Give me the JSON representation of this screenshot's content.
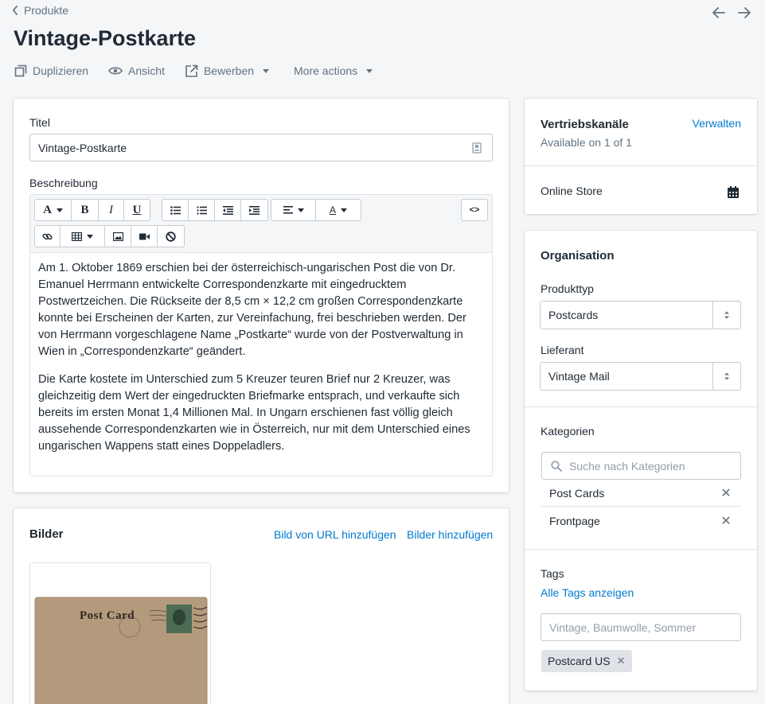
{
  "header": {
    "breadcrumb": "Produkte",
    "title": "Vintage-Postkarte",
    "actions": {
      "duplicate": "Duplizieren",
      "view": "Ansicht",
      "promote": "Bewerben",
      "more": "More actions"
    }
  },
  "main": {
    "title_label": "Titel",
    "title_value": "Vintage-Postkarte",
    "description_label": "Beschreibung",
    "description": [
      "Am 1. Oktober 1869 erschien bei der österreichisch-ungarischen Post die von Dr. Emanuel Herrmann entwickelte Correspondenzkarte mit eingedrucktem Postwertzeichen. Die Rückseite der 8,5 cm × 12,2 cm großen Correspondenzkarte konnte bei Erscheinen der Karten, zur Vereinfachung, frei beschrieben werden. Der von Herrmann vorgeschlagene Name „Postkarte“ wurde von der Postverwaltung in Wien in „Correspondenzkarte“ geändert.",
      "Die Karte kostete im Unterschied zum 5 Kreuzer teuren Brief nur 2 Kreuzer, was gleichzeitig dem Wert der eingedruckten Briefmarke entsprach, und verkaufte sich bereits im ersten Monat 1,4 Millionen Mal. In Ungarn erschienen fast völlig gleich aussehende Correspondenzkarten wie in Österreich, nur mit dem Unterschied eines ungarischen Wappens statt eines Doppeladlers."
    ],
    "toolbar": {
      "bold": "B",
      "italic": "I",
      "underline": "U",
      "html": "<>"
    }
  },
  "images": {
    "title": "Bilder",
    "add_from_url": "Bild von URL hinzufügen",
    "add_images": "Bilder hinzufügen",
    "postcard_text": "Post Card"
  },
  "sidebar": {
    "channels": {
      "title": "Vertriebskanäle",
      "manage": "Verwalten",
      "availability": "Available on 1 of 1",
      "store": "Online Store"
    },
    "organization": {
      "title": "Organisation",
      "product_type_label": "Produkttyp",
      "product_type_value": "Postcards",
      "vendor_label": "Lieferant",
      "vendor_value": "Vintage Mail",
      "categories_label": "Kategorien",
      "categories_placeholder": "Suche nach Kategorien",
      "categories": [
        "Post Cards",
        "Frontpage"
      ],
      "tags_label": "Tags",
      "tags_link": "Alle Tags anzeigen",
      "tags_placeholder": "Vintage, Baumwolle, Sommer",
      "tags": [
        "Postcard US"
      ]
    }
  }
}
